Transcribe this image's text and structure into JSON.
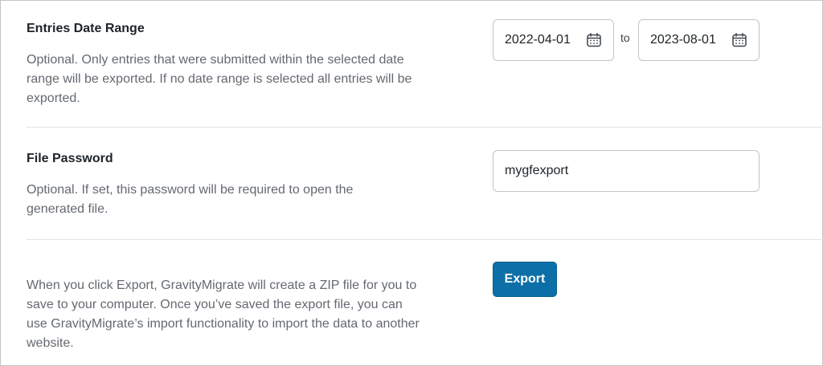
{
  "date_range": {
    "label": "Entries Date Range",
    "description": "Optional. Only entries that were submitted within the selected date range will be exported. If no date range is selected all entries will be exported.",
    "start_value": "2022-04-01",
    "separator": "to",
    "end_value": "2023-08-01",
    "icon": "calendar-icon"
  },
  "password": {
    "label": "File Password",
    "description": "Optional. If set, this password will be required to open the generated file.",
    "value": "mygfexport"
  },
  "export": {
    "description": "When you click Export, GravityMigrate will create a ZIP file for you to save to your computer. Once you’ve saved the export file, you can use GravityMigrate’s import functionality to import the data to another website.",
    "button_label": "Export",
    "button_color": "#0c6fa8"
  }
}
